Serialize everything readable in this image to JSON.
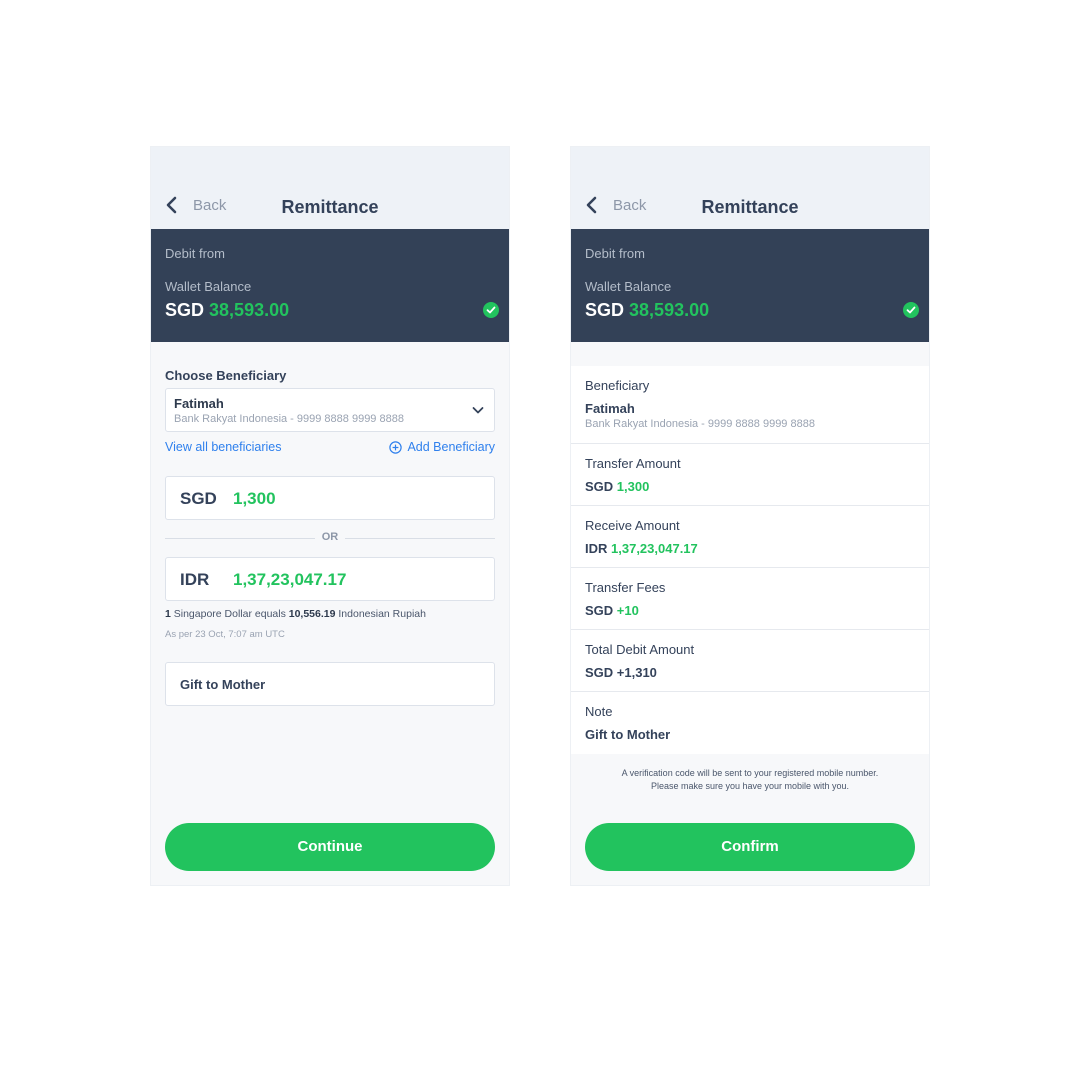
{
  "colors": {
    "accent": "#22c35e",
    "header_bg": "#334157",
    "link": "#2f80ed"
  },
  "left": {
    "nav": {
      "back_label": "Back",
      "title": "Remittance"
    },
    "debit": {
      "from_label": "Debit from",
      "wallet_label": "Wallet Balance",
      "currency": "SGD",
      "amount": "38,593.00"
    },
    "beneficiary": {
      "label": "Choose Beneficiary",
      "name": "Fatimah",
      "bank": "Bank Rakyat Indonesia - 9999 8888 9999 8888",
      "view_all": "View all beneficiaries",
      "add": "Add Beneficiary"
    },
    "send": {
      "currency": "SGD",
      "value": "1,300"
    },
    "or_label": "OR",
    "receive": {
      "currency": "IDR",
      "value": "1,37,23,047.17"
    },
    "rate": {
      "from_amount": "1",
      "from_text": " Singapore Dollar equals ",
      "to_amount": "10,556.19",
      "to_text": " Indonesian Rupiah",
      "timestamp": "As per 23 Oct, 7:07 am UTC"
    },
    "note": "Gift to Mother",
    "button": "Continue"
  },
  "right": {
    "nav": {
      "back_label": "Back",
      "title": "Remittance"
    },
    "debit": {
      "from_label": "Debit from",
      "wallet_label": "Wallet Balance",
      "currency": "SGD",
      "amount": "38,593.00"
    },
    "beneficiary": {
      "label": "Beneficiary",
      "name": "Fatimah",
      "bank": "Bank Rakyat Indonesia - 9999 8888 9999 8888"
    },
    "transfer": {
      "label": "Transfer Amount",
      "currency": "SGD",
      "value": "1,300"
    },
    "receive": {
      "label": "Receive Amount",
      "currency": "IDR",
      "value": "1,37,23,047.17"
    },
    "fees": {
      "label": "Transfer Fees",
      "currency": "SGD",
      "value": "+10"
    },
    "total": {
      "label": "Total Debit Amount",
      "value": "SGD +1,310"
    },
    "note": {
      "label": "Note",
      "value": "Gift to Mother"
    },
    "verify_line1": "A verification code will be sent to your registered mobile number.",
    "verify_line2": "Please make sure you have your mobile with you.",
    "button": "Confirm"
  }
}
